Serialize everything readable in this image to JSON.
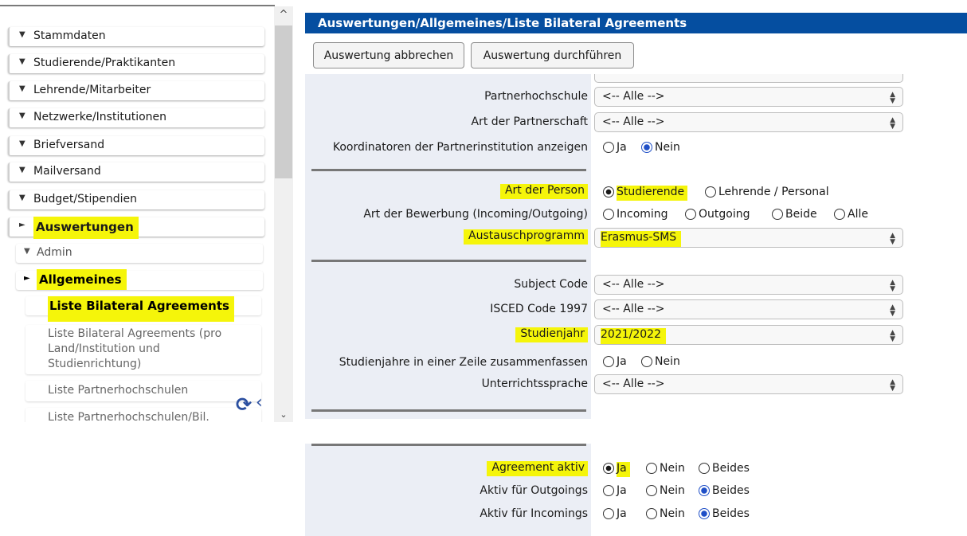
{
  "sidebar": {
    "items": [
      {
        "label": "Stammdaten"
      },
      {
        "label": "Studierende/Praktikanten"
      },
      {
        "label": "Lehrende/Mitarbeiter"
      },
      {
        "label": "Netzwerke/Institutionen"
      },
      {
        "label": "Briefversand"
      },
      {
        "label": "Mailversand"
      },
      {
        "label": "Budget/Stipendien"
      },
      {
        "label": "Auswertungen"
      }
    ],
    "sub_items": [
      {
        "label": "Admin"
      },
      {
        "label": "Allgemeines"
      }
    ],
    "leaves": [
      {
        "label": "Liste Bilateral Agreements"
      },
      {
        "label_lines": [
          "Liste Bilateral Agreements (pro",
          "Land/Institution und",
          "Studienrichtung)"
        ]
      },
      {
        "label": "Liste Partnerhochschulen"
      },
      {
        "label": "Liste Partnerhochschulen/Bil."
      }
    ],
    "icons": {
      "refresh": "refresh-icon",
      "collapse": "chevron-left-icon",
      "scroll_up": "chevron-up-icon",
      "scroll_down": "chevron-down-icon"
    }
  },
  "header": {
    "title": "Auswertungen/Allgemeines/Liste Bilateral Agreements"
  },
  "toolbar": {
    "cancel_label": "Auswertung abbrechen",
    "run_label": "Auswertung durchführen"
  },
  "form": {
    "partnerhochschule": {
      "label": "Partnerhochschule",
      "value": "<-- Alle -->"
    },
    "art_partnerschaft": {
      "label": "Art der Partnerschaft",
      "value": "<-- Alle -->"
    },
    "koordinatoren": {
      "label": "Koordinatoren der Partnerinstitution anzeigen",
      "options": [
        "Ja",
        "Nein"
      ],
      "selected": "Nein"
    },
    "art_person": {
      "label": "Art der Person",
      "options": [
        "Studierende",
        "Lehrende / Personal"
      ],
      "selected": "Studierende"
    },
    "art_bewerbung": {
      "label": "Art der Bewerbung (Incoming/Outgoing)",
      "options": [
        "Incoming",
        "Outgoing",
        "Beide",
        "Alle"
      ],
      "selected": null
    },
    "austauschprogramm": {
      "label": "Austauschprogramm",
      "value": "Erasmus-SMS"
    },
    "subject_code": {
      "label": "Subject Code",
      "value": "<-- Alle -->"
    },
    "isced": {
      "label": "ISCED Code 1997",
      "value": "<-- Alle -->"
    },
    "studienjahr": {
      "label": "Studienjahr",
      "value": "2021/2022"
    },
    "studienjahre_zeile": {
      "label": "Studienjahre in einer Zeile zusammenfassen",
      "options": [
        "Ja",
        "Nein"
      ],
      "selected": null
    },
    "unterrichtssprache": {
      "label": "Unterrichtssprache",
      "value": "<-- Alle -->"
    }
  },
  "bottom": {
    "agreement_aktiv": {
      "label": "Agreement aktiv",
      "options": [
        "Ja",
        "Nein",
        "Beides"
      ],
      "selected": "Ja"
    },
    "aktiv_outgoings": {
      "label": "Aktiv für Outgoings",
      "options": [
        "Ja",
        "Nein",
        "Beides"
      ],
      "selected": "Beides"
    },
    "aktiv_incomings": {
      "label": "Aktiv für Incomings",
      "options": [
        "Ja",
        "Nein",
        "Beides"
      ],
      "selected": "Beides"
    }
  },
  "colors": {
    "header_bg": "#054ea0",
    "highlight": "#f5f50a",
    "radio_selected": "#1f4fc7"
  }
}
